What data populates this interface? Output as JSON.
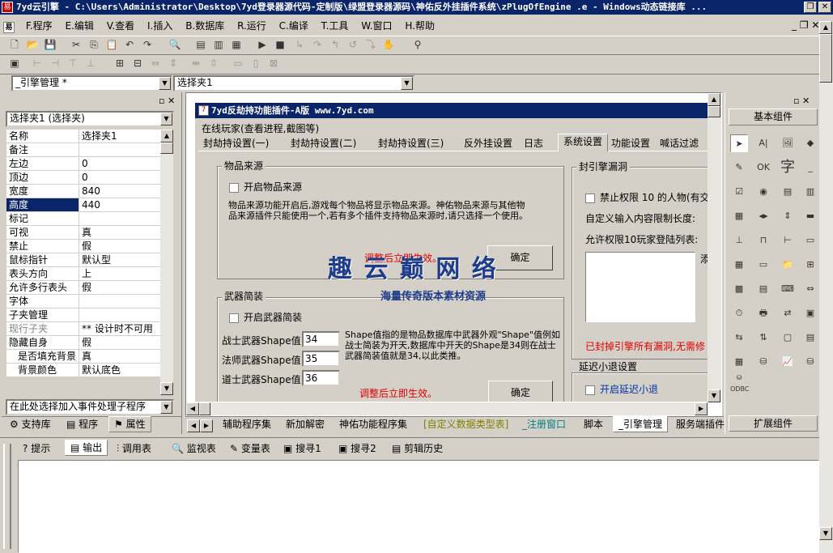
{
  "window": {
    "title": "7yd云引擎 - C:\\Users\\Administrator\\Desktop\\7yd登录器源代码-定制版\\绿盟登录器源码\\神佑反外挂插件系统\\zPlugOfEngine .e - Windows动态链接库 ..."
  },
  "menu": [
    "F.程序",
    "E.编辑",
    "V.查看",
    "I.插入",
    "B.数据库",
    "R.运行",
    "C.编译",
    "T.工具",
    "W.窗口",
    "H.帮助"
  ],
  "toolbar": {
    "combo1": "_引擎管理 *",
    "combo2": "选择夹1"
  },
  "props": {
    "object": "选择夹1 (选择夹)",
    "rows": [
      {
        "name": "名称",
        "value": "选择夹1"
      },
      {
        "name": "备注",
        "value": ""
      },
      {
        "name": "左边",
        "value": "0"
      },
      {
        "name": "顶边",
        "value": "0"
      },
      {
        "name": "宽度",
        "value": "840"
      },
      {
        "name": "高度",
        "value": "440"
      },
      {
        "name": "标记",
        "value": ""
      },
      {
        "name": "可视",
        "value": "真"
      },
      {
        "name": "禁止",
        "value": "假"
      },
      {
        "name": "鼠标指针",
        "value": "默认型"
      },
      {
        "name": "表头方向",
        "value": "上"
      },
      {
        "name": "允许多行表头",
        "value": "假"
      },
      {
        "name": "字体",
        "value": ""
      },
      {
        "name": "子夹管理",
        "value": ""
      },
      {
        "name": "现行子夹",
        "value": "** 设计时不可用"
      },
      {
        "name": "隐藏自身",
        "value": "假"
      },
      {
        "name": "是否填充背景",
        "value": "真"
      },
      {
        "name": "背景颜色",
        "value": "默认底色"
      }
    ],
    "event_combo": "在此处选择加入事件处理子程序",
    "bottom_tabs": [
      "支持库",
      "程序",
      "属性"
    ]
  },
  "form": {
    "title": "7yd反劫持功能插件-A版 www.7yd.com",
    "online_label": "在线玩家(查看进程,截图等)",
    "tabs": [
      "封劫持设置(一)",
      "封劫持设置(二)",
      "封劫持设置(三)",
      "反外挂设置",
      "日志",
      "系统设置",
      "功能设置",
      "喊话过滤"
    ],
    "item_source": {
      "title": "物品来源",
      "check": "开启物品来源",
      "desc": "物品来源功能开启后,游戏每个物品将显示物品来源。神佑物品来源与其他物品来源插件只能使用一个,若有多个插件支持物品来源时,请只选择一个使用。",
      "note": "调整后立即生效。",
      "ok": "确定"
    },
    "weapon": {
      "title": "武器简装",
      "check": "开启武器简装",
      "warrior_label": "战士武器Shape值:",
      "warrior_val": "34",
      "mage_label": "法师武器Shape值:",
      "mage_val": "35",
      "taoist_label": "道士武器Shape值:",
      "taoist_val": "36",
      "desc": "Shape值指的是物品数据库中武器外观\"Shape\"值例如战士简装为开天,数据库中开天的Shape是34则在战士武器简装值就是34,以此类推。",
      "note": "调整后立即生效。",
      "ok": "确定"
    },
    "engine_hole": {
      "title": "封引擎漏洞",
      "check": "禁止权限 10 的人物(有交",
      "custom": "自定义输入内容限制长度:",
      "allow": "允许权限10玩家登陆列表:",
      "note": "已封掉引擎所有漏洞,无需修",
      "side": "添"
    },
    "delay": {
      "title": "延迟小退设置",
      "check": "开启延迟小退"
    }
  },
  "watermark": {
    "line1": "趣 云 巅 网 络",
    "line2": "海量传奇版本素材资源"
  },
  "editor_tabs": [
    "辅助程序集",
    "新加解密",
    "神佑功能程序集",
    "[自定义数据类型表]",
    "_注册窗口",
    "脚本",
    "_引擎管理",
    "服务端插件"
  ],
  "output_tabs": [
    "提示",
    "输出",
    "调用表",
    "监视表",
    "变量表",
    "搜寻1",
    "搜寻2",
    "剪辑历史"
  ],
  "components": {
    "basic": "基本组件",
    "ext": "扩展组件",
    "odbc": "ODBC"
  }
}
